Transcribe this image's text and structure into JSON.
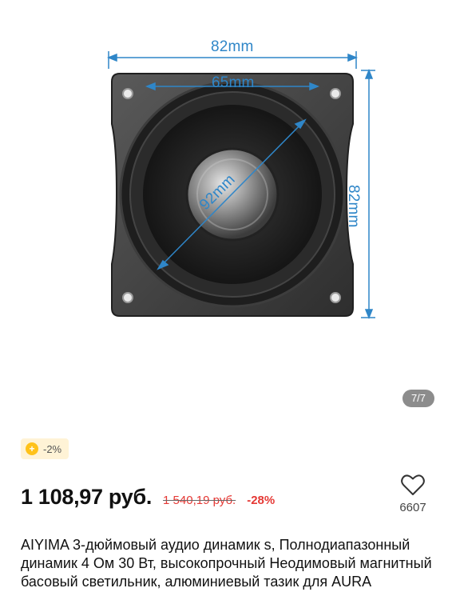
{
  "gallery": {
    "dimensions": {
      "width_label": "82mm",
      "height_label": "82mm",
      "inner_label": "65mm",
      "diagonal_label": "92mm"
    },
    "counter": "7/7",
    "accent_color": "#2f86c8"
  },
  "coupon": {
    "icon": "coin-icon",
    "label": "-2%"
  },
  "pricing": {
    "price": "1 108,97 руб.",
    "old_price": "1 540,19 руб.",
    "discount": "-28%"
  },
  "wishlist": {
    "icon": "heart-icon",
    "count": "6607"
  },
  "product": {
    "title": "AIYIMA 3-дюймовый аудио динамик s, Полнодиапазонный динамик 4 Ом 30 Вт, высокопрочный Неодимовый магнитный басовый светильник, алюминиевый тазик для AURA"
  }
}
